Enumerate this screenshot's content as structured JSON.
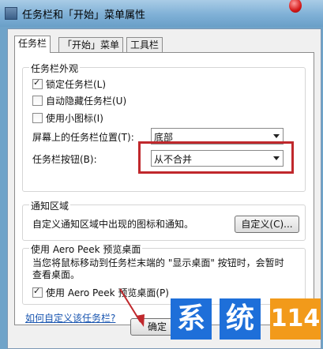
{
  "window": {
    "title": "任务栏和「开始」菜单属性"
  },
  "tabs": [
    {
      "label": "任务栏"
    },
    {
      "label": "「开始」菜单"
    },
    {
      "label": "工具栏"
    }
  ],
  "appearance": {
    "title": "任务栏外观",
    "lock": {
      "label": "锁定任务栏(L)",
      "checked": true
    },
    "autohide": {
      "label": "自动隐藏任务栏(U)",
      "checked": false
    },
    "small_icons": {
      "label": "使用小图标(I)",
      "checked": false
    },
    "location_label": "屏幕上的任务栏位置(T):",
    "location_value": "底部",
    "buttons_label": "任务栏按钮(B):",
    "buttons_value": "从不合并"
  },
  "notification": {
    "title": "通知区域",
    "text": "自定义通知区域中出现的图标和通知。",
    "customize_button": "自定义(C)..."
  },
  "peek": {
    "title": "使用 Aero Peek 预览桌面",
    "desc_line1": "当您将鼠标移动到任务栏末端的 \"显示桌面\" 按钮时，会暂时",
    "desc_line2": "查看桌面。",
    "checkbox": {
      "label": "使用 Aero Peek 预览桌面(P)",
      "checked": true
    }
  },
  "help_link": "如何自定义该任务栏?",
  "ok_button": "确定",
  "watermark": {
    "chars": [
      "系",
      "统",
      "114"
    ],
    "colors": [
      "#1e6fd9",
      "#1e6fd9",
      "#f29a1a"
    ]
  },
  "colors": {
    "highlight": "#c0282c",
    "link": "#1a56b0"
  }
}
